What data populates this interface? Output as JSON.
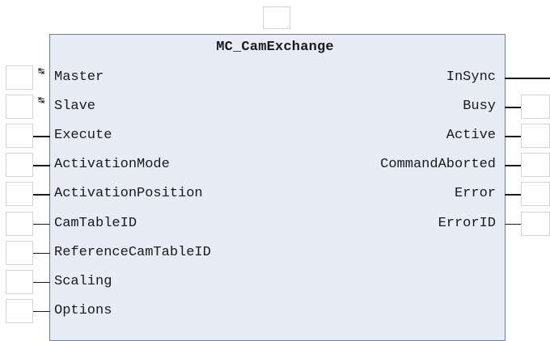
{
  "block": {
    "type_name": "MC_CamExchange"
  },
  "inputs": [
    {
      "name": "Master",
      "in_out": true
    },
    {
      "name": "Slave",
      "in_out": true
    },
    {
      "name": "Execute",
      "in_out": false
    },
    {
      "name": "ActivationMode",
      "in_out": false
    },
    {
      "name": "ActivationPosition",
      "in_out": false
    },
    {
      "name": "CamTableID",
      "in_out": false
    },
    {
      "name": "ReferenceCamTableID",
      "in_out": false
    },
    {
      "name": "Scaling",
      "in_out": false
    },
    {
      "name": "Options",
      "in_out": false
    }
  ],
  "outputs": [
    {
      "name": "InSync",
      "box": false
    },
    {
      "name": "Busy",
      "box": true
    },
    {
      "name": "Active",
      "box": true
    },
    {
      "name": "CommandAborted",
      "box": true
    },
    {
      "name": "Error",
      "box": true
    },
    {
      "name": "ErrorID",
      "box": true
    }
  ],
  "icons": {
    "in_out_arrow": "↹"
  },
  "colors": {
    "block_fill": "#e8ecf5",
    "block_border": "#6b7f9e",
    "input_box_border": "#d2d2d2",
    "wire": "#1a1a1a"
  }
}
